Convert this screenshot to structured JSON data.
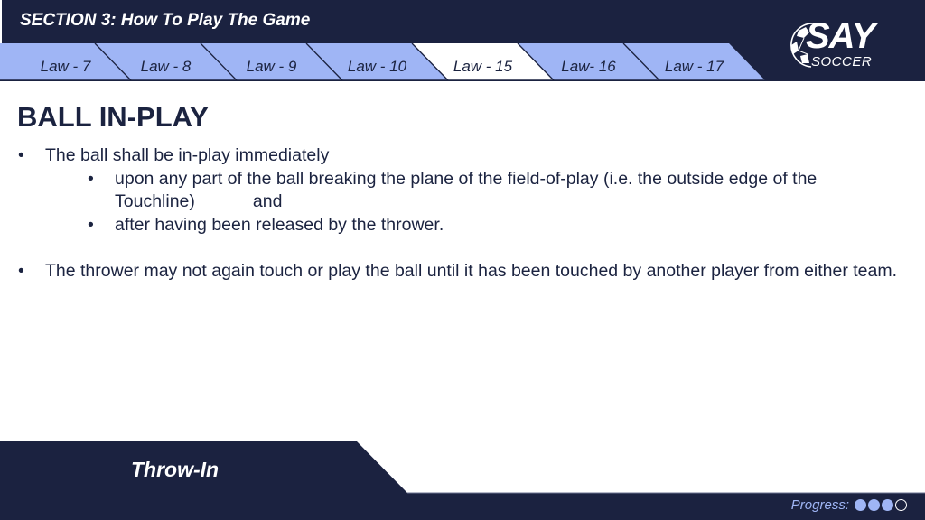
{
  "header": {
    "section_title": "SECTION 3:  How To Play The Game"
  },
  "tabs": [
    {
      "label": "Law - 7",
      "active": false
    },
    {
      "label": "Law - 8",
      "active": false
    },
    {
      "label": "Law - 9",
      "active": false
    },
    {
      "label": "Law - 10",
      "active": false
    },
    {
      "label": "Law - 15",
      "active": true
    },
    {
      "label": "Law- 16",
      "active": false
    },
    {
      "label": "Law - 17",
      "active": false
    }
  ],
  "logo": {
    "main": "SAY",
    "sub": "SOCCER",
    "icon": "soccer-ball-icon"
  },
  "page": {
    "title": "BALL IN-PLAY",
    "bullets": [
      {
        "level": 1,
        "marker": "•",
        "text": "The ball shall be in-play immediately"
      },
      {
        "level": 2,
        "marker": "•",
        "text": "upon any part of the ball breaking the plane of the field-of-play (i.e. the outside edge of the Touchline)",
        "suffix": "and"
      },
      {
        "level": 2,
        "marker": "•",
        "text": "after having been released by the thrower."
      },
      {
        "level": 1,
        "marker": "•",
        "text": "The thrower may not again touch or play the ball until it has been touched by another player from either team."
      }
    ]
  },
  "footer": {
    "topic": "Throw-In",
    "progress_label": "Progress:",
    "progress_filled": 3,
    "progress_total": 4
  },
  "colors": {
    "navy": "#1b2240",
    "tab_blue": "#9fb5f5",
    "active_tab": "#ffffff",
    "text": "#1b2340"
  }
}
